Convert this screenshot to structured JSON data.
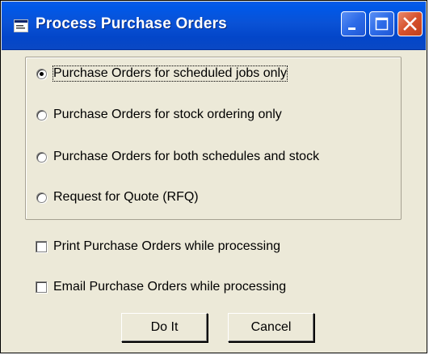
{
  "window": {
    "title": "Process Purchase Orders",
    "title_icon": "form-window-icon",
    "controls": [
      "minimize-icon",
      "maximize-icon",
      "close-icon"
    ]
  },
  "order_type": {
    "options": [
      {
        "label": "Purchase Orders for scheduled jobs only",
        "selected": true
      },
      {
        "label": "Purchase Orders for stock ordering only",
        "selected": false
      },
      {
        "label": "Purchase Orders for both schedules and stock",
        "selected": false
      },
      {
        "label": "Request for Quote (RFQ)",
        "selected": false
      }
    ]
  },
  "options": {
    "print_label": "Print Purchase Orders while processing",
    "print_checked": false,
    "email_label": "Email Purchase Orders while processing",
    "email_checked": false
  },
  "buttons": {
    "do_it": "Do It",
    "cancel": "Cancel"
  },
  "colors": {
    "titlebar": "#0a52d6",
    "face": "#ece9d8",
    "close_button": "#d6512c"
  }
}
